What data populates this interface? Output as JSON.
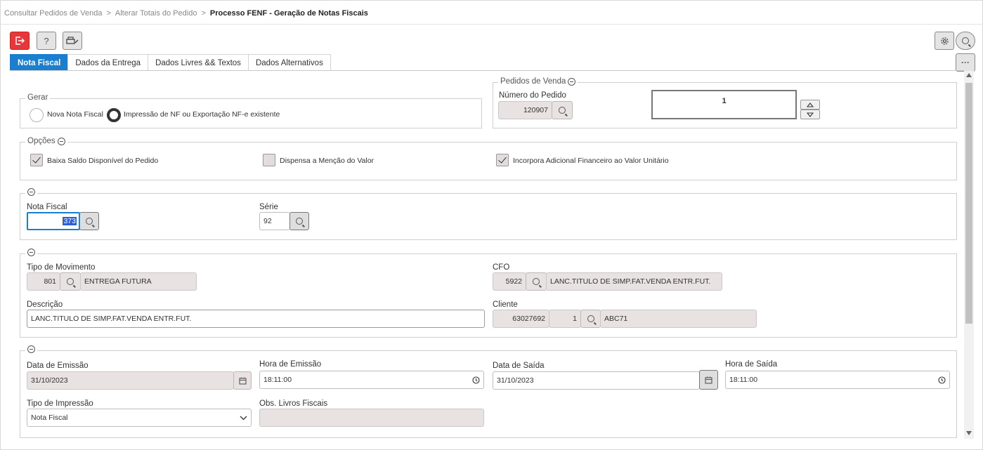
{
  "breadcrumb": {
    "items": [
      "Consultar Pedidos de Venda",
      "Alterar Totais do Pedido"
    ],
    "current": "Processo FENF - Geração de Notas Fiscais",
    "separator": ">"
  },
  "toolbar": {
    "help_label": "?",
    "more_label": "···"
  },
  "tabs": [
    "Nota Fiscal",
    "Dados da Entrega",
    "Dados Livres && Textos",
    "Dados Alternativos"
  ],
  "gerar": {
    "title": "Gerar",
    "option_new": "Nova Nota Fiscal",
    "option_print": "Impressão de NF ou Exportação NF-e existente",
    "selected": "option_print"
  },
  "pedidos": {
    "title": "Pedidos de Venda",
    "numero_label": "Número do Pedido",
    "numero_value": "120907",
    "counter_value": "1"
  },
  "opcoes": {
    "title": "Opções",
    "baixa_label": "Baixa Saldo Disponível do Pedido",
    "baixa_checked": true,
    "dispensa_label": "Dispensa a Menção do Valor",
    "dispensa_checked": false,
    "incorpora_label": "Incorpora Adicional Financeiro ao Valor Unitário",
    "incorpora_checked": true
  },
  "nota": {
    "nf_label": "Nota Fiscal",
    "nf_value": "373",
    "serie_label": "Série",
    "serie_value": "92"
  },
  "movimento": {
    "tipo_label": "Tipo de Movimento",
    "tipo_code": "801",
    "tipo_desc": "ENTREGA FUTURA",
    "cfo_label": "CFO",
    "cfo_code": "5922",
    "cfo_desc": "LANC.TITULO DE SIMP.FAT.VENDA ENTR.FUT.",
    "descricao_label": "Descrição",
    "descricao_value": "LANC.TITULO DE SIMP.FAT.VENDA ENTR.FUT.",
    "cliente_label": "Cliente",
    "cliente_code": "63027692",
    "cliente_seq": "1",
    "cliente_name": "ABC71"
  },
  "datas": {
    "emissao_label": "Data de Emissão",
    "emissao_value": "31/10/2023",
    "hora_emissao_label": "Hora de Emissão",
    "hora_emissao_value": "18:11:00",
    "saida_label": "Data de Saída",
    "saida_value": "31/10/2023",
    "hora_saida_label": "Hora de Saída",
    "hora_saida_value": "18:11:00",
    "tipo_impressao_label": "Tipo de Impressão",
    "tipo_impressao_value": "Nota Fiscal",
    "obs_label": "Obs. Livros Fiscais",
    "obs_value": ""
  },
  "colors": {
    "accent": "#1a7fd0",
    "exit_button": "#e8373a",
    "readonly_field": "#e8e2e2",
    "selection": "#2b5fd9"
  }
}
